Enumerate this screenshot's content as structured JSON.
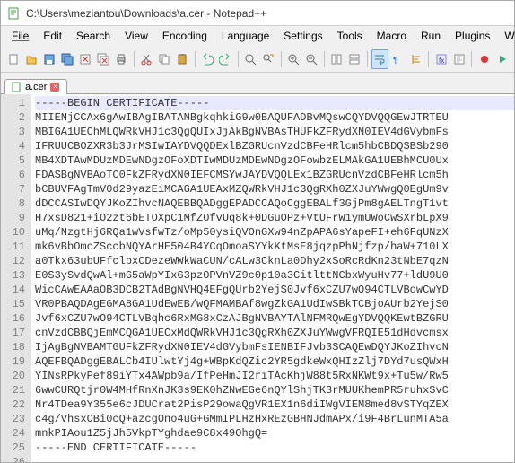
{
  "window": {
    "title": "C:\\Users\\meziantou\\Downloads\\a.cer - Notepad++"
  },
  "menu": {
    "items": [
      "File",
      "Edit",
      "Search",
      "View",
      "Encoding",
      "Language",
      "Settings",
      "Tools",
      "Macro",
      "Run",
      "Plugins",
      "Window"
    ]
  },
  "toolbar": {
    "icons": [
      "new-file-icon",
      "open-file-icon",
      "save-icon",
      "save-all-icon",
      "close-icon",
      "close-all-icon",
      "print-icon",
      "sep",
      "cut-icon",
      "copy-icon",
      "paste-icon",
      "sep",
      "undo-icon",
      "redo-icon",
      "sep",
      "find-icon",
      "replace-icon",
      "sep",
      "zoom-in-icon",
      "zoom-out-icon",
      "sep",
      "sync-v-icon",
      "sync-h-icon",
      "sep",
      "wrap-icon",
      "whitespace-icon",
      "indent-guide-icon",
      "sep",
      "lang-icon",
      "doc-map-icon",
      "sep",
      "record-icon",
      "play-icon"
    ]
  },
  "tab": {
    "label": "a.cer"
  },
  "file": {
    "lines": [
      "-----BEGIN CERTIFICATE-----",
      "MIIENjCCAx6gAwIBAgIBATANBgkqhkiG9w0BAQUFADBvMQswCQYDVQQGEwJTRTEU",
      "MBIGA1UEChMLQWRkVHJ1c3QgQUIxJjAkBgNVBAsTHUFkZFRydXN0IEV4dGVybmFs",
      "IFRUUCBOZXR3b3JrMSIwIAYDVQQDExlBZGRUcnVzdCBFeHRlcm5hbCBDQSBSb290",
      "MB4XDTAwMDUzMDEwNDgzOFoXDTIwMDUzMDEwNDgzOFowbzELMAkGA1UEBhMCU0Ux",
      "FDASBgNVBAoTC0FkZFRydXN0IEFCMSYwJAYDVQQLEx1BZGRUcnVzdCBFeHRlcm5h",
      "bCBUVFAgTmV0d29yazEiMCAGA1UEAxMZQWRkVHJ1c3QgRXh0ZXJuYWwgQ0EgUm9v",
      "dDCCASIwDQYJKoZIhvcNAQEBBQADggEPADCCAQoCggEBALf3GjPm8gAELTngT1vt",
      "H7xsD821+iO2zt6bETOXpC1MfZOfvUq8k+0DGuOPz+VtUFrW1ymUWoCwSXrbLpX9",
      "uMq/NzgtHj6RQa1wVsfwTz/oMp50ysiQVOnGXw94nZpAPA6sYapeFI+eh6FqUNzX",
      "mk6vBbOmcZSccbNQYArHE504B4YCqOmoaSYYkKtMsE8jqzpPhNjfzp/haW+710LX",
      "a0Tkx63ubUFfclpxCDezeWWkWaCUN/cALw3CknLa0Dhy2xSoRcRdKn23tNbE7qzN",
      "E0S3ySvdQwAl+mG5aWpYIxG3pzOPVnVZ9c0p10a3CitlttNCbxWyuHv77+ldU9U0",
      "WicCAwEAAaOB3DCB2TAdBgNVHQ4EFgQUrb2YejS0Jvf6xCZU7wO94CTLVBowCwYD",
      "VR0PBAQDAgEGMA8GA1UdEwEB/wQFMAMBAf8wgZkGA1UdIwSBkTCBjoAUrb2YejS0",
      "Jvf6xCZU7wO94CTLVBqhc6RxMG8xCzAJBgNVBAYTAlNFMRQwEgYDVQQKEwtBZGRU",
      "cnVzdCBBQjEmMCQGA1UECxMdQWRkVHJ1c3QgRXh0ZXJuYWwgVFRQIE51dHdvcmsx",
      "IjAgBgNVBAMTGUFkZFRydXN0IEV4dGVybmFsIENBIFJvb3SCAQEwDQYJKoZIhvcN",
      "AQEFBQADggEBALCb4IUlwtYj4g+WBpKdQZic2YR5gdkeWxQHIzZlj7DYd7usQWxH",
      "YINsRPkyPef89iYTx4AWpb9a/IfPeHmJI2riTAcKhjW88t5RxNKWt9x+Tu5w/Rw5",
      "6wwCURQtjr0W4MHfRnXnJK3s9EK0hZNwEGe6nQYlShjTK3rMUUKhemPR5ruhxSvC",
      "Nr4TDea9Y355e6cJDUCrat2PisP29owaQgVR1EX1n6diIWgVIEM8med8vSTYqZEX",
      "c4g/VhsxOBi0cQ+azcgOno4uG+GMmIPLHzHxREzGBHNJdmAPx/i9F4BrLunMTA5a",
      "mnkPIAou1Z5jJh5VkpTYghdae9C8x49OhgQ=",
      "-----END CERTIFICATE-----",
      ""
    ]
  }
}
